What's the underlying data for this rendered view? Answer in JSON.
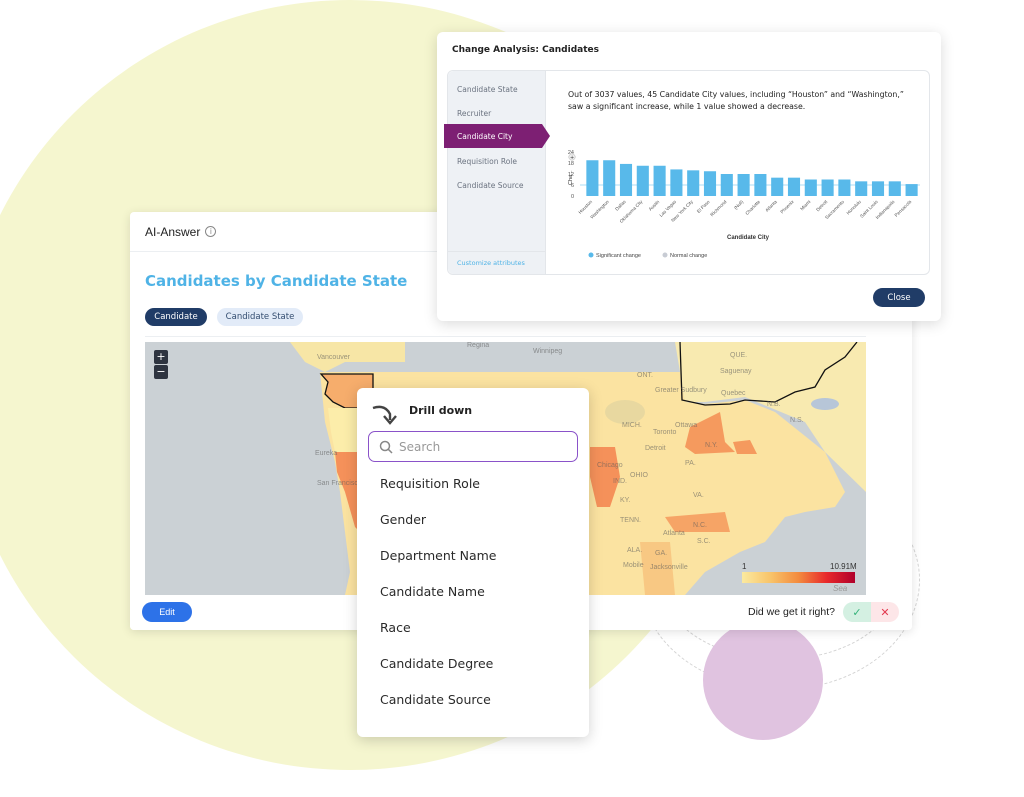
{
  "ai_answer": {
    "header_title": "AI-Answer",
    "chart_title": "Candidates by Candidate State",
    "chips": [
      "Candidate",
      "Candidate State"
    ],
    "map": {
      "zoom_in": "+",
      "zoom_out": "−",
      "labels": [
        "Vancouver",
        "Regina",
        "Winnipeg",
        "Eureka",
        "San Francisco",
        "ONT.",
        "QUE.",
        "Saguenay",
        "Greater Sudbury",
        "Quebec",
        "N.B.",
        "N.S.",
        "MICH.",
        "Toronto",
        "Ottawa",
        "Detroit",
        "Chicago",
        "OHIO",
        "IND.",
        "KY.",
        "TENN.",
        "N.C.",
        "S.C.",
        "Atlanta",
        "ALA.",
        "GA.",
        "Mobile",
        "Jacksonville",
        "N.Y.",
        "PA.",
        "VA."
      ],
      "legend": {
        "min": "1",
        "max": "10.91M",
        "water_label": "Sea"
      }
    },
    "edit_label": "Edit",
    "feedback_question": "Did we get it right?",
    "feedback_yes": "✓",
    "feedback_no": "✕"
  },
  "change_analysis": {
    "title": "Change Analysis: Candidates",
    "attributes": [
      "Candidate State",
      "Recruiter",
      "Candidate City",
      "Requisition Role",
      "Candidate Source"
    ],
    "active_attribute": "Candidate City",
    "customize_label": "Customize attributes",
    "summary": "Out of 3037 values, 45 Candidate City values, including “Houston” and “Washington,” saw a significant increase, while 1 value showed a decrease.",
    "close_label": "Close"
  },
  "chart_data": {
    "type": "bar",
    "title": "",
    "xlabel": "Candidate City",
    "ylabel": "Cha...",
    "ylim": [
      0,
      24
    ],
    "yticks": [
      0,
      6,
      12,
      18,
      24
    ],
    "reference_line": 6,
    "categories": [
      "Houston",
      "Washington",
      "Dallas",
      "Oklahoma City",
      "Austin",
      "Las Vegas",
      "New York City",
      "El Paso",
      "Richmond",
      "(Null)",
      "Charlotte",
      "Atlanta",
      "Phoenix",
      "Miami",
      "Detroit",
      "Sacramento",
      "Honolulu",
      "Saint Louis",
      "Indianapolis",
      "Pensacola"
    ],
    "values": [
      19.5,
      19.5,
      17.5,
      16.5,
      16.5,
      14.5,
      14,
      13.5,
      12,
      12,
      12,
      10,
      10,
      9,
      9,
      9,
      8,
      8,
      8,
      6.5
    ],
    "legend": [
      {
        "name": "Significant change",
        "color": "#58b9ea"
      },
      {
        "name": "Normal change",
        "color": "#c8ccd4"
      }
    ],
    "legend_position": "bottom-left"
  },
  "drill_down": {
    "title": "Drill down",
    "search_placeholder": "Search",
    "items": [
      "Requisition Role",
      "Gender",
      "Department Name",
      "Candidate Name",
      "Race",
      "Candidate Degree",
      "Candidate Source"
    ]
  },
  "colors": {
    "accent_blue": "#4fb3e6",
    "navy": "#203c67",
    "purple_active": "#7d1f73",
    "edit_blue": "#2d72e8",
    "bar_blue": "#58b9ea"
  }
}
